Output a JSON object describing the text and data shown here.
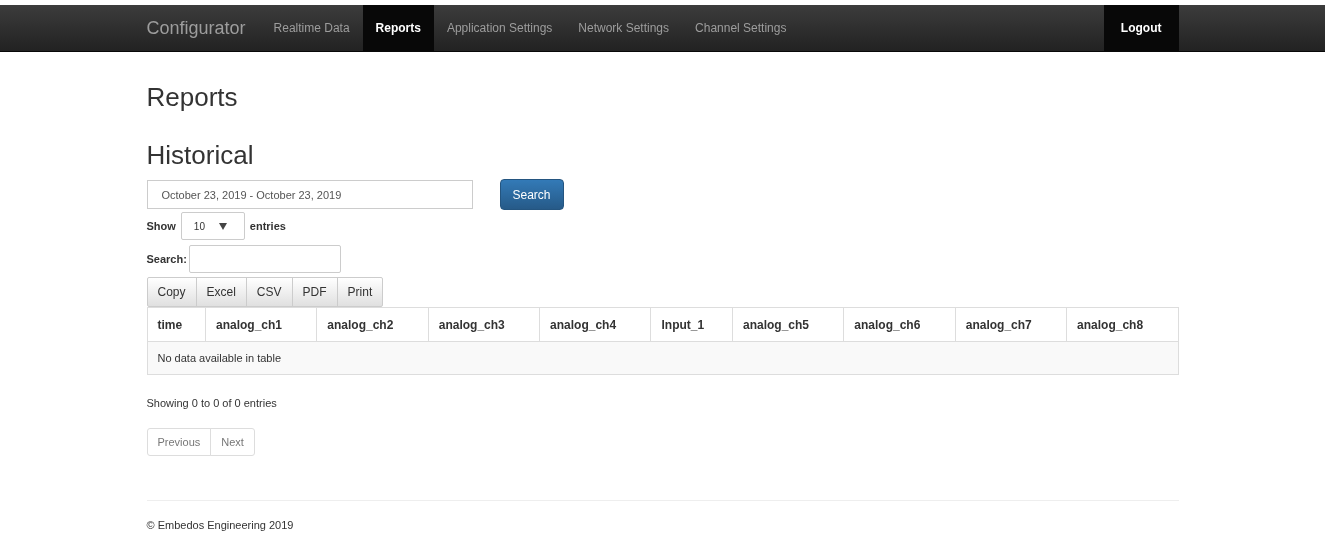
{
  "navbar": {
    "brand": "Configurator",
    "items": [
      {
        "label": "Realtime Data",
        "selected": false
      },
      {
        "label": "Reports",
        "selected": true
      },
      {
        "label": "Application Settings",
        "selected": false
      },
      {
        "label": "Network Settings",
        "selected": false
      },
      {
        "label": "Channel Settings",
        "selected": false
      }
    ],
    "logout": "Logout"
  },
  "page_title": "Reports",
  "section_title": "Historical",
  "date_range": {
    "value": "October 23, 2019 - October 23, 2019"
  },
  "search_button": "Search",
  "length": {
    "prefix": "Show",
    "value": "10",
    "suffix": "entries"
  },
  "filter": {
    "label": "Search:"
  },
  "export_buttons": [
    "Copy",
    "Excel",
    "CSV",
    "PDF",
    "Print"
  ],
  "table": {
    "columns": [
      "time",
      "analog_ch1",
      "analog_ch2",
      "analog_ch3",
      "analog_ch4",
      "Input_1",
      "analog_ch5",
      "analog_ch6",
      "analog_ch7",
      "analog_ch8"
    ],
    "empty_message": "No data available in table"
  },
  "info": "Showing 0 to 0 of 0 entries",
  "pagination": [
    {
      "label": "Previous",
      "disabled": true
    },
    {
      "label": "Next",
      "disabled": true
    }
  ],
  "footer": "© Embedos Engineering 2019"
}
